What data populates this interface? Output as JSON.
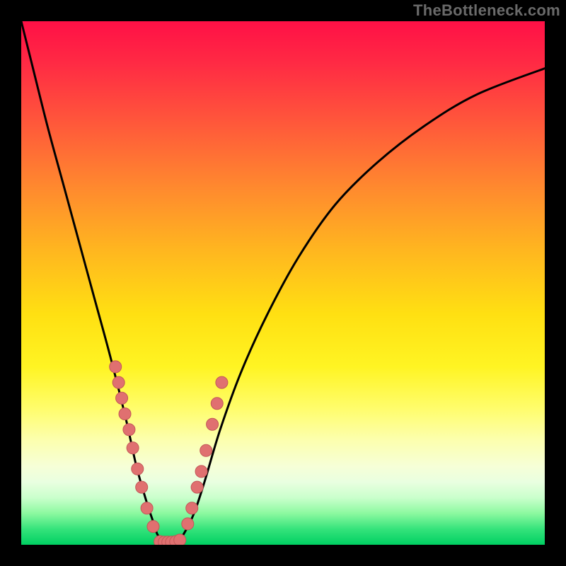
{
  "watermark": "TheBottleneck.com",
  "colors": {
    "frame": "#000000",
    "curve": "#000000",
    "marker_fill": "#e07070",
    "marker_stroke": "#c25858",
    "gradient_top": "#ff1046",
    "gradient_bottom": "#00d062"
  },
  "chart_data": {
    "type": "line",
    "title": "",
    "xlabel": "",
    "ylabel": "",
    "xlim": [
      0,
      100
    ],
    "ylim": [
      0,
      100
    ],
    "grid": false,
    "annotations": [
      "TheBottleneck.com"
    ],
    "series": [
      {
        "name": "bottleneck-curve",
        "x": [
          0,
          2,
          5,
          8,
          11,
          14,
          17,
          20,
          22,
          24,
          25,
          26,
          27,
          28,
          29,
          30,
          31,
          33,
          35,
          38,
          42,
          47,
          53,
          60,
          68,
          77,
          87,
          100
        ],
        "y": [
          100,
          92,
          80,
          69,
          58,
          47,
          36,
          24,
          15,
          8,
          5,
          2,
          1,
          0.5,
          0.5,
          1,
          2,
          6,
          12,
          22,
          33,
          44,
          55,
          65,
          73,
          80,
          86,
          91
        ]
      }
    ],
    "markers": [
      {
        "name": "left-cluster",
        "points": [
          [
            18,
            34
          ],
          [
            18.6,
            31
          ],
          [
            19.2,
            28
          ],
          [
            19.8,
            25
          ],
          [
            20.6,
            22
          ],
          [
            21.3,
            18.5
          ],
          [
            22.2,
            14.5
          ],
          [
            23.0,
            11
          ],
          [
            24.0,
            7
          ],
          [
            25.2,
            3.5
          ]
        ]
      },
      {
        "name": "valley-cluster",
        "points": [
          [
            26.5,
            0.6
          ],
          [
            27.3,
            0.5
          ],
          [
            28.0,
            0.5
          ],
          [
            28.7,
            0.5
          ],
          [
            29.5,
            0.6
          ],
          [
            30.3,
            0.9
          ]
        ]
      },
      {
        "name": "right-cluster",
        "points": [
          [
            31.8,
            4
          ],
          [
            32.6,
            7
          ],
          [
            33.6,
            11
          ],
          [
            34.4,
            14
          ],
          [
            35.3,
            18
          ],
          [
            36.5,
            23
          ],
          [
            37.4,
            27
          ],
          [
            38.3,
            31
          ]
        ]
      }
    ],
    "marker_radius": 1.15
  }
}
